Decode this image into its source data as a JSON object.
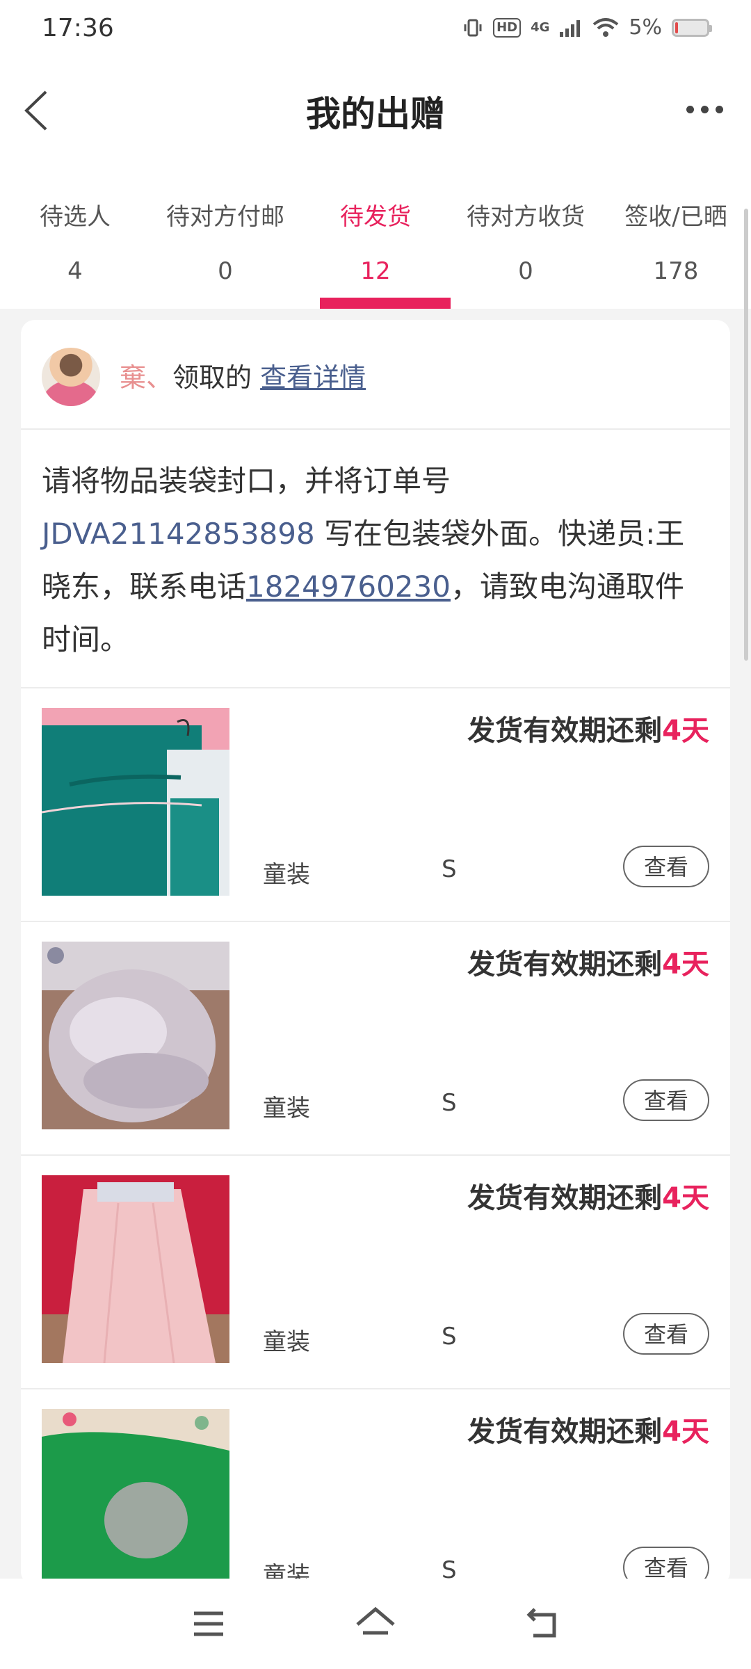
{
  "status_bar": {
    "time": "17:36",
    "network": "4G",
    "hd": "HD",
    "battery": "5%"
  },
  "header": {
    "title": "我的出赠"
  },
  "tabs": [
    {
      "label": "待选人",
      "count": "4"
    },
    {
      "label": "待对方付邮",
      "count": "0"
    },
    {
      "label": "待发货",
      "count": "12"
    },
    {
      "label": "待对方收货",
      "count": "0"
    },
    {
      "label": "签收/已晒",
      "count": "178"
    }
  ],
  "active_tab": 2,
  "card": {
    "nickname": "棄、",
    "claimed_text": "领取的",
    "detail_link": "查看详情",
    "notice": {
      "part1": "请将物品装袋封口，并将订单号",
      "order_no": "JDVA21142853898",
      "part2": "写在包装袋外面。快递员:王晓东，联系电话",
      "phone": "18249760230",
      "part3": "，请致电沟通取件时间。"
    }
  },
  "items": [
    {
      "deadline_prefix": "发货有效期还剩",
      "deadline_days": "4天",
      "category": "童装",
      "size": "S",
      "button": "查看"
    },
    {
      "deadline_prefix": "发货有效期还剩",
      "deadline_days": "4天",
      "category": "童装",
      "size": "S",
      "button": "查看"
    },
    {
      "deadline_prefix": "发货有效期还剩",
      "deadline_days": "4天",
      "category": "童装",
      "size": "S",
      "button": "查看"
    },
    {
      "deadline_prefix": "发货有效期还剩",
      "deadline_days": "4天",
      "category": "童装",
      "size": "S",
      "button": "查看"
    }
  ],
  "colors": {
    "accent": "#e8225d",
    "link": "#4a5f8e",
    "nickname": "#e89090"
  }
}
